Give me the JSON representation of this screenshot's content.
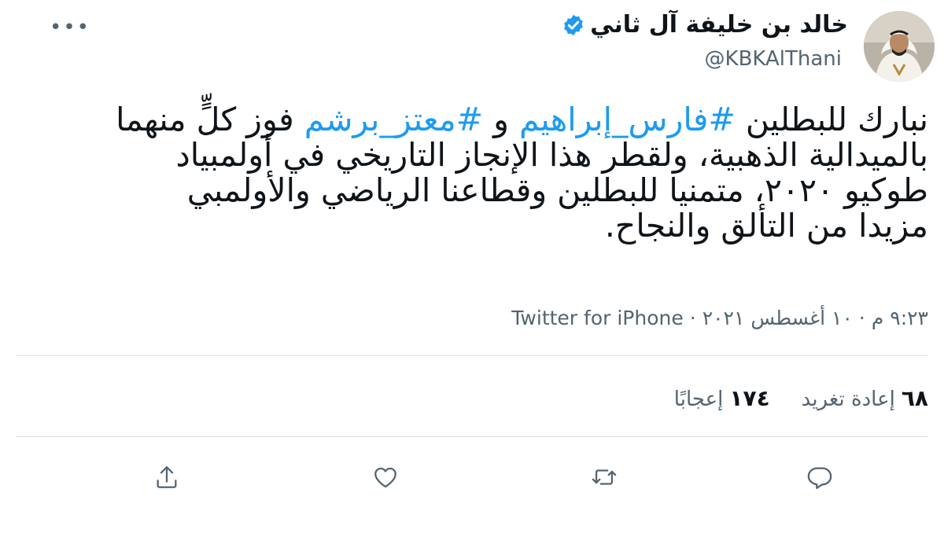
{
  "author": {
    "display_name": "خالد بن خليفة آل ثاني",
    "handle": "@KBKAlThani",
    "verified": true
  },
  "tweet": {
    "lines": [
      {
        "before": "نبارك للبطلين ",
        "tag1": "#فارس_إبراهيم",
        "mid": " و ",
        "tag2": "#معتز_برشم",
        "after": " فوز كلٍّ منهما"
      },
      {
        "text": "بالميدالية الذهبية، ولقطر هذا الإنجاز التاريخي في أولمبياد"
      },
      {
        "text": "طوكيو ٢٠٢٠، متمنيا للبطلين وقطاعنا الرياضي والأولمبي"
      },
      {
        "text": "مزيدا من التألق والنجاح."
      }
    ]
  },
  "meta": {
    "time": "٩:٢٣ م",
    "sep1": "·",
    "date": "١٠ أغسطس ٢٠٢١",
    "sep2": "·",
    "source": "Twitter for iPhone"
  },
  "stats": {
    "retweets_count": "٦٨",
    "retweets_label": "إعادة تغريد",
    "likes_count": "١٧٤",
    "likes_label": "إعجابًا"
  },
  "actions": {
    "reply": "reply-icon",
    "retweet": "retweet-icon",
    "like": "heart-icon",
    "share": "share-icon"
  },
  "colors": {
    "accent": "#1d9bf0",
    "text": "#0f1419",
    "secondary": "#536471"
  }
}
